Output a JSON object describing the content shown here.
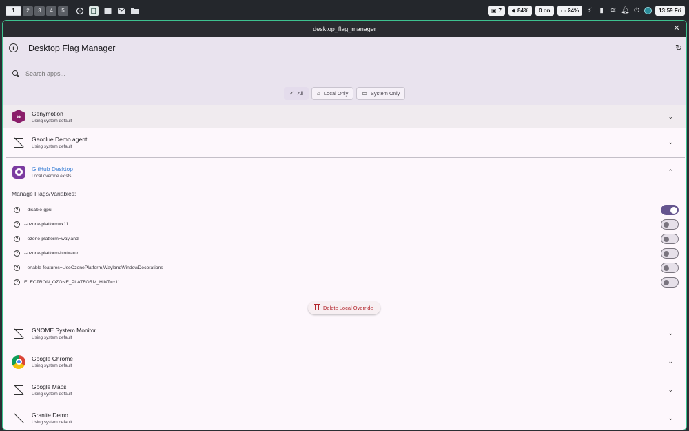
{
  "topbar": {
    "workspaces": [
      "1",
      "2",
      "3",
      "4",
      "5"
    ],
    "active_workspace": "1",
    "tray_left_icons": [
      "openai-icon",
      "app-icon",
      "storage-icon",
      "mail-icon",
      "folder-icon"
    ],
    "indicators": {
      "updates": "7",
      "volume": "84%",
      "bluetooth": "0 on",
      "battery": "24%"
    },
    "tray_right_icons": [
      "bolt-icon",
      "stats-icon",
      "layers-icon",
      "bell-icon",
      "power-icon",
      "avatar-icon"
    ],
    "clock": "13:59 Fri"
  },
  "window": {
    "title": "desktop_flag_manager",
    "app_title": "Desktop Flag Manager",
    "search_placeholder": "Search apps...",
    "filters": [
      {
        "label": "All",
        "selected": true
      },
      {
        "label": "Local Only",
        "selected": false
      },
      {
        "label": "System Only",
        "selected": false
      }
    ]
  },
  "apps_before": [
    {
      "name": "Genymotion",
      "status": "Using system default",
      "icon": "genymotion-icon"
    },
    {
      "name": "Geoclue Demo agent",
      "status": "Using system default",
      "icon": "no-image-icon"
    }
  ],
  "expanded_app": {
    "name": "GitHub Desktop",
    "status": "Local override exists",
    "icon": "github-desktop-icon",
    "flags_title": "Manage Flags/Variables:",
    "flags": [
      {
        "label": "--disable-gpu",
        "enabled": true
      },
      {
        "label": "--ozone-platform=x11",
        "enabled": false
      },
      {
        "label": "--ozone-platform=wayland",
        "enabled": false
      },
      {
        "label": "--ozone-platform-hint=auto",
        "enabled": false
      },
      {
        "label": "--enable-features=UseOzonePlatform,WaylandWindowDecorations",
        "enabled": false
      },
      {
        "label": "ELECTRON_OZONE_PLATFORM_HINT=x11",
        "enabled": false
      }
    ],
    "delete_label": "Delete Local Override"
  },
  "apps_after": [
    {
      "name": "GNOME System Monitor",
      "status": "Using system default",
      "icon": "no-image-icon"
    },
    {
      "name": "Google Chrome",
      "status": "Using system default",
      "icon": "chrome-icon"
    },
    {
      "name": "Google Maps",
      "status": "Using system default",
      "icon": "no-image-icon"
    },
    {
      "name": "Granite Demo",
      "status": "Using system default",
      "icon": "no-image-icon"
    }
  ],
  "colors": {
    "accent": "#65558f",
    "link": "#3d82d6",
    "danger": "#b3262d",
    "window_border": "#3ec28f"
  }
}
